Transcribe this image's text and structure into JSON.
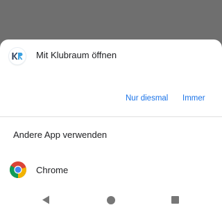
{
  "dialog": {
    "app_name": "Mit Klubraum öffnen",
    "app_icon": "klubraum-kr-logo-icon",
    "actions": {
      "once_label": "Nur diesmal",
      "always_label": "Immer"
    },
    "other_apps_heading": "Andere App verwenden",
    "apps": [
      {
        "label": "Chrome",
        "icon": "chrome-icon"
      }
    ]
  },
  "navbar": {
    "back": "back-triangle-icon",
    "home": "home-circle-icon",
    "recents": "recents-square-icon"
  },
  "colors": {
    "accent": "#1a73e8",
    "scrim": "#6f6f6f",
    "sheet": "#ffffff"
  }
}
